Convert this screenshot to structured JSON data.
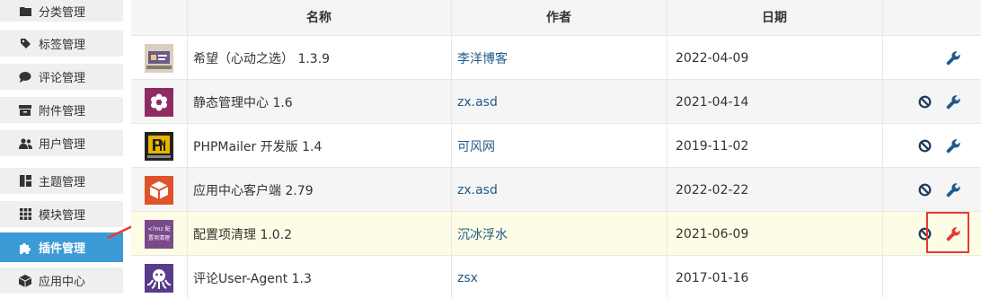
{
  "sidebar": {
    "items": [
      {
        "label": "分类管理",
        "icon": "folder-icon"
      },
      {
        "label": "标签管理",
        "icon": "tag-icon"
      },
      {
        "label": "评论管理",
        "icon": "comment-icon"
      },
      {
        "label": "附件管理",
        "icon": "archive-icon"
      },
      {
        "label": "用户管理",
        "icon": "users-icon"
      },
      {
        "label": "主题管理",
        "icon": "layout-icon"
      },
      {
        "label": "模块管理",
        "icon": "grid-icon"
      },
      {
        "label": "插件管理",
        "icon": "puzzle-icon",
        "active": true
      },
      {
        "label": "应用中心",
        "icon": "cube-icon"
      }
    ]
  },
  "table": {
    "headers": {
      "name": "名称",
      "author": "作者",
      "date": "日期"
    },
    "rows": [
      {
        "name": "希望（心动之选） 1.3.9",
        "author": "李洋博客",
        "date": "2022-04-09",
        "actions": [
          "settings"
        ]
      },
      {
        "name": "静态管理中心 1.6",
        "author": "zx.asd",
        "date": "2021-04-14",
        "actions": [
          "disable",
          "settings"
        ]
      },
      {
        "name": "PHPMailer 开发版 1.4",
        "author": "可风网",
        "date": "2019-11-02",
        "actions": [
          "disable",
          "settings"
        ]
      },
      {
        "name": "应用中心客户端 2.79",
        "author": "zx.asd",
        "date": "2022-02-22",
        "actions": [
          "disable",
          "settings"
        ]
      },
      {
        "name": "配置项清理 1.0.2",
        "author": "沉冰浮水",
        "date": "2021-06-09",
        "actions": [
          "disable",
          "settings"
        ],
        "highlight": true,
        "logo_text": "<?mz 配置项清理"
      },
      {
        "name": "评论User-Agent 1.3",
        "author": "zsx",
        "date": "2017-01-16",
        "actions": []
      }
    ]
  },
  "colors": {
    "accent": "#3c9bd6",
    "link": "#1f5a8a",
    "highlight": "#fcfde4",
    "alert": "#e53935"
  }
}
